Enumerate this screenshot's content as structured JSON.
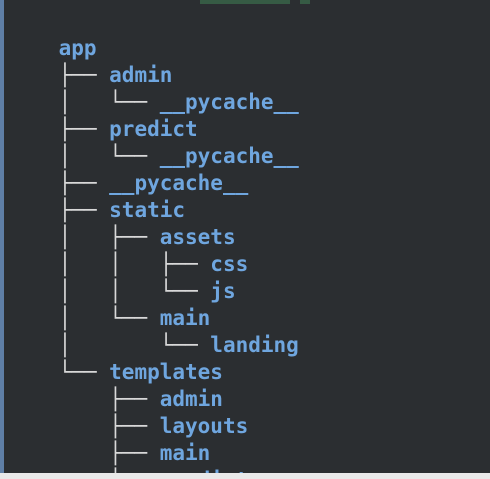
{
  "tree": {
    "lines": [
      {
        "prefix": "",
        "name": "app"
      },
      {
        "prefix": "├── ",
        "name": "admin"
      },
      {
        "prefix": "│   └── ",
        "name": "__pycache__"
      },
      {
        "prefix": "├── ",
        "name": "predict"
      },
      {
        "prefix": "│   └── ",
        "name": "__pycache__"
      },
      {
        "prefix": "├── ",
        "name": "__pycache__"
      },
      {
        "prefix": "├── ",
        "name": "static"
      },
      {
        "prefix": "│   ├── ",
        "name": "assets"
      },
      {
        "prefix": "│   │   ├── ",
        "name": "css"
      },
      {
        "prefix": "│   │   └── ",
        "name": "js"
      },
      {
        "prefix": "│   └── ",
        "name": "main"
      },
      {
        "prefix": "│       └── ",
        "name": "landing"
      },
      {
        "prefix": "└── ",
        "name": "templates"
      },
      {
        "prefix": "    ├── ",
        "name": "admin"
      },
      {
        "prefix": "    ├── ",
        "name": "layouts"
      },
      {
        "prefix": "    ├── ",
        "name": "main"
      },
      {
        "prefix": "    └── ",
        "name": "predict"
      }
    ]
  },
  "colors": {
    "background": "#2b2e31",
    "directory": "#6fa6df",
    "branch": "#d8d8d8"
  }
}
